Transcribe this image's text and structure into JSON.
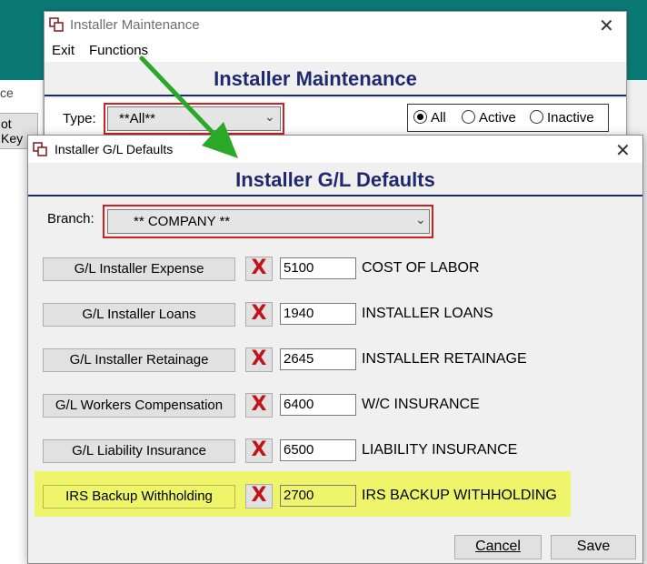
{
  "background": {
    "left_text": "ce",
    "button_label": "ot Key"
  },
  "installer_window": {
    "title": "Installer Maintenance",
    "menu": {
      "exit": "Exit",
      "functions": "Functions"
    },
    "heading": "Installer Maintenance",
    "type_label": "Type:",
    "type_value": "**All**",
    "radios": [
      {
        "label": "All",
        "selected": true
      },
      {
        "label": "Active",
        "selected": false
      },
      {
        "label": "Inactive",
        "selected": false
      }
    ]
  },
  "gl_dialog": {
    "title": "Installer G/L Defaults",
    "heading": "Installer G/L Defaults",
    "branch_label": "Branch:",
    "branch_value": "** COMPANY **",
    "rows": [
      {
        "button": "G/L Installer Expense",
        "account": "5100",
        "description": "COST OF LABOR"
      },
      {
        "button": "G/L Installer Loans",
        "account": "1940",
        "description": "INSTALLER LOANS"
      },
      {
        "button": "G/L Installer Retainage",
        "account": "2645",
        "description": "INSTALLER RETAINAGE"
      },
      {
        "button": "G/L Workers Compensation",
        "account": "6400",
        "description": "W/C INSURANCE"
      },
      {
        "button": "G/L Liability Insurance",
        "account": "6500",
        "description": "LIABILITY INSURANCE"
      },
      {
        "button": "IRS Backup Withholding",
        "account": "2700",
        "description": "IRS BACKUP WITHHOLDING"
      }
    ],
    "clear_glyph": "X",
    "cancel": "Cancel",
    "save": "Save"
  },
  "colors": {
    "teal_background": "#0b7a75",
    "heading_navy": "#1f2a6e",
    "annotation_red": "#d02020",
    "annotation_arrow_green": "#2aa828",
    "highlight_yellow": "#eef56a",
    "clear_x_red": "#c0141a"
  }
}
